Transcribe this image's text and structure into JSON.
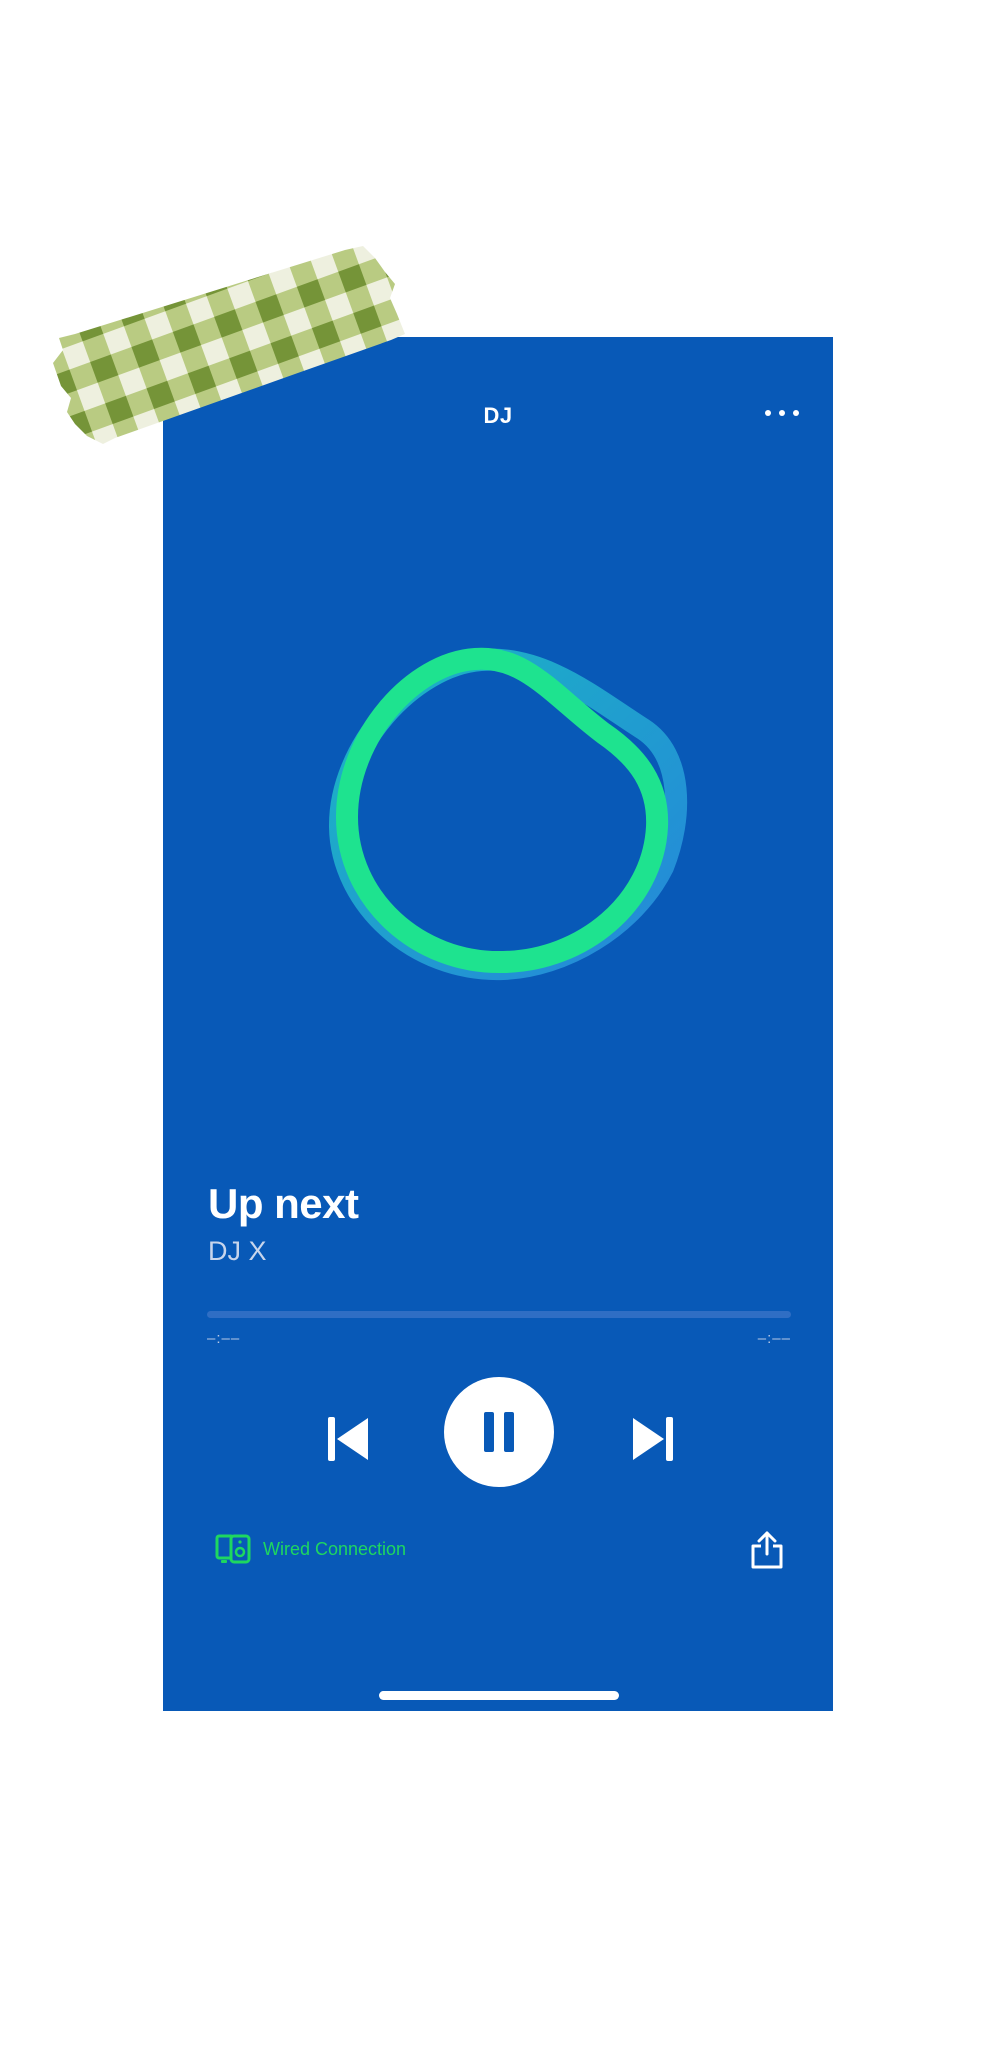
{
  "header": {
    "title": "DJ",
    "more_icon": "more-horizontal-icon"
  },
  "artwork": {
    "icon": "dj-ring-icon",
    "ring_color": "#1ee38f",
    "shadow_color": "#2a8fe0"
  },
  "track": {
    "title": "Up next",
    "artist": "DJ X"
  },
  "progress": {
    "elapsed": "–:––",
    "remaining": "–:––",
    "fraction": 0
  },
  "controls": {
    "previous_icon": "skip-back-icon",
    "pause_icon": "pause-icon",
    "next_icon": "skip-forward-icon"
  },
  "device": {
    "icon": "devices-icon",
    "label": "Wired Connection"
  },
  "share": {
    "icon": "share-icon"
  },
  "colors": {
    "background": "#0859b7",
    "accent": "#1ed760",
    "text": "#ffffff",
    "tape_green": "#7a9a3a"
  },
  "decoration": {
    "tape": "gingham-washi-tape"
  }
}
